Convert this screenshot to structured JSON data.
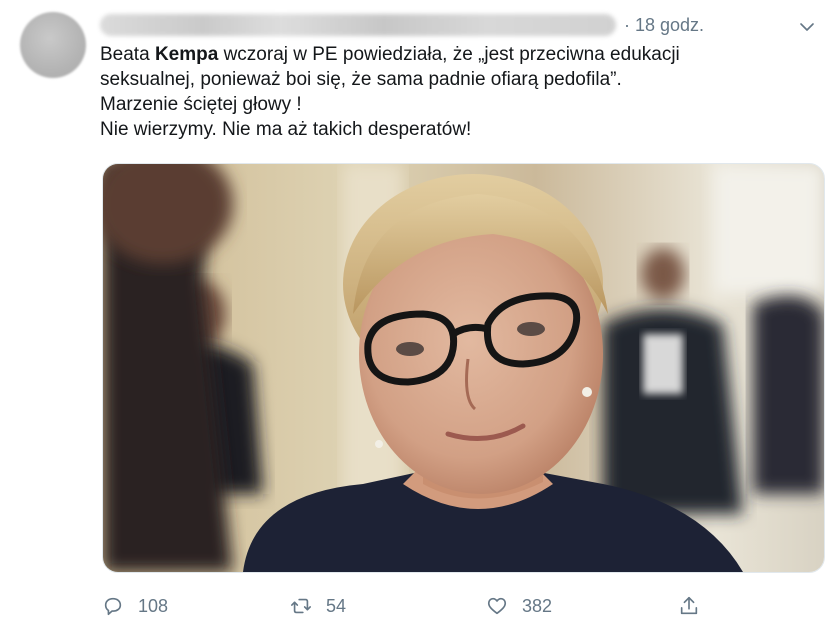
{
  "tweet": {
    "time": "· 18 godz.",
    "text": {
      "line1_a": "Beata ",
      "line1_b": "Kempa",
      "line1_c": " wczoraj w PE powiedziała, że „jest przeciwna edukacji",
      "line2": "seksualnej, ponieważ boi się, że sama padnie ofiarą pedofila”.",
      "line3": "Marzenie ściętej głowy !",
      "line4": "Nie wierzymy. Nie ma aż takich desperatów!"
    },
    "media": {
      "kind": "photo"
    }
  },
  "actions": {
    "reply": {
      "icon": "reply-icon",
      "count": "108"
    },
    "retweet": {
      "icon": "retweet-icon",
      "count": "54"
    },
    "like": {
      "icon": "heart-icon",
      "count": "382"
    },
    "share": {
      "icon": "share-icon"
    }
  },
  "colors": {
    "text": "#14171a",
    "secondary": "#657786",
    "border": "#e1e8ed"
  }
}
